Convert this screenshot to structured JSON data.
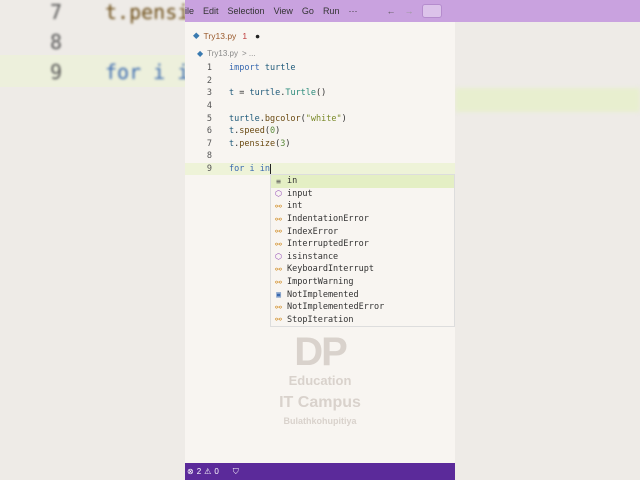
{
  "menu": [
    "ile",
    "Edit",
    "Selection",
    "View",
    "Go",
    "Run",
    "···"
  ],
  "tab": {
    "name": "Try13.py",
    "problems": "1",
    "dirty": "●"
  },
  "breadcrumb": {
    "file": "Try13.py",
    "rest": "> ..."
  },
  "code": [
    {
      "n": "1",
      "t": "import turtle"
    },
    {
      "n": "2",
      "t": ""
    },
    {
      "n": "3",
      "t": "t = turtle.Turtle()"
    },
    {
      "n": "4",
      "t": ""
    },
    {
      "n": "5",
      "t": "turtle.bgcolor(\"white\")"
    },
    {
      "n": "6",
      "t": "t.speed(0)"
    },
    {
      "n": "7",
      "t": "t.pensize(3)"
    },
    {
      "n": "8",
      "t": ""
    },
    {
      "n": "9",
      "t": "for i in"
    }
  ],
  "suggestions": [
    {
      "label": "in",
      "kind": "keyword"
    },
    {
      "label": "input",
      "kind": "function"
    },
    {
      "label": "int",
      "kind": "class"
    },
    {
      "label": "IndentationError",
      "kind": "class"
    },
    {
      "label": "IndexError",
      "kind": "class"
    },
    {
      "label": "InterruptedError",
      "kind": "class"
    },
    {
      "label": "isinstance",
      "kind": "function"
    },
    {
      "label": "KeyboardInterrupt",
      "kind": "class"
    },
    {
      "label": "ImportWarning",
      "kind": "class"
    },
    {
      "label": "NotImplemented",
      "kind": "constant"
    },
    {
      "label": "NotImplementedError",
      "kind": "class"
    },
    {
      "label": "StopIteration",
      "kind": "class"
    }
  ],
  "watermark": {
    "logo": "DP",
    "line1": "Education",
    "line2": "IT Campus",
    "line3": "Bulathkohupitiya"
  },
  "status": {
    "errors": "2",
    "warnings": "0"
  },
  "background": {
    "left_lines": [
      {
        "n": "7",
        "t": "t.pensi"
      },
      {
        "n": "8",
        "t": ""
      },
      {
        "n": "9",
        "t": "for i i"
      }
    ]
  }
}
